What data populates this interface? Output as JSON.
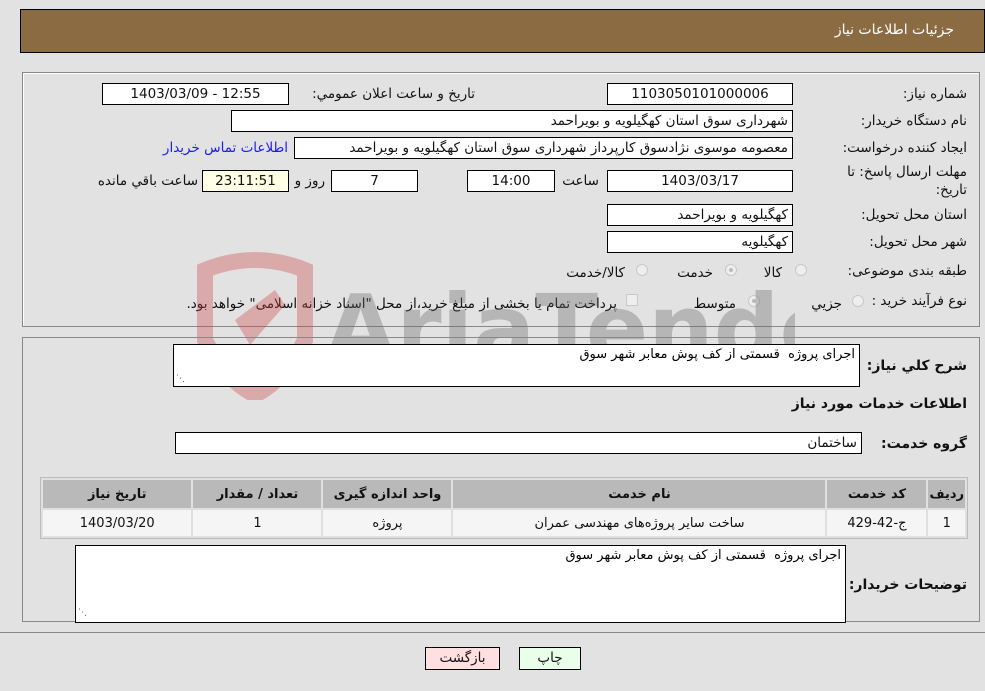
{
  "header": {
    "title": "جزئیات اطلاعات نیاز"
  },
  "fields": {
    "need_number": {
      "label": "شماره نیاز:",
      "value": "1103050101000006"
    },
    "announce": {
      "label": "تاريخ و ساعت اعلان عمومي:",
      "value": "1403/03/09 - 12:55"
    },
    "buyer_org": {
      "label": "نام دستگاه خریدار:",
      "value": "شهرداری سوق استان کهگیلویه و بویراحمد"
    },
    "requester": {
      "label": "ایجاد کننده درخواست:",
      "value": "معصومه موسوی نژادسوق کارپرداز شهرداری سوق استان کهگیلویه و بویراحمد",
      "contact_link": "اطلاعات تماس خریدار"
    },
    "deadline": {
      "label_line1": "مهلت ارسال پاسخ: تا",
      "label_line2": "تاریخ:",
      "date": "1403/03/17",
      "time_label": "ساعت",
      "time": "14:00",
      "days": "7",
      "days_label": "روز و",
      "remaining": "23:11:51",
      "remaining_label": "ساعت باقي مانده"
    },
    "province": {
      "label": "استان محل تحویل:",
      "value": "کهگیلویه و بویراحمد"
    },
    "city": {
      "label": "شهر محل تحویل:",
      "value": "کهگیلویه"
    },
    "category": {
      "label": "طبقه بندی موضوعی:",
      "options": [
        "کالا",
        "خدمت",
        "کالا/خدمت"
      ],
      "selected": "خدمت"
    },
    "process": {
      "label": "نوع فرآیند خرید :",
      "options": [
        "جزيي",
        "متوسط"
      ],
      "selected": "متوسط",
      "treasury_note": "پرداخت تمام یا بخشی از مبلغ خرید،از محل \"اسناد خزانه اسلامی\" خواهد بود.",
      "treasury_checked": false
    }
  },
  "description": {
    "label": "شرح كلي نياز:",
    "value": "اجرای پروژه  قسمتی از کف پوش معابر شهر سوق"
  },
  "services_title": "اطلاعات خدمات مورد نياز",
  "service_group": {
    "label": "گروه خدمت:",
    "value": "ساختمان"
  },
  "table": {
    "headers": [
      "رديف",
      "کد خدمت",
      "نام خدمت",
      "واحد اندازه گيری",
      "تعداد / مقدار",
      "تاريخ نياز"
    ],
    "rows": [
      [
        "1",
        "ج-42-429",
        "ساخت سایر پروژه‌های مهندسی عمران",
        "پروژه",
        "1",
        "1403/03/20"
      ]
    ]
  },
  "buyer_notes": {
    "label": "توضیحات خریدار:",
    "value": "اجرای پروژه  قسمتی از کف پوش معابر شهر سوق"
  },
  "buttons": {
    "print": "چاپ",
    "back": "بازگشت"
  },
  "colors": {
    "header_bg": "#8b6c42",
    "print_bg": "#eaffea",
    "back_bg": "#ffe0e0",
    "link": "#1a1aff"
  },
  "watermark": "AriaTender.neT"
}
